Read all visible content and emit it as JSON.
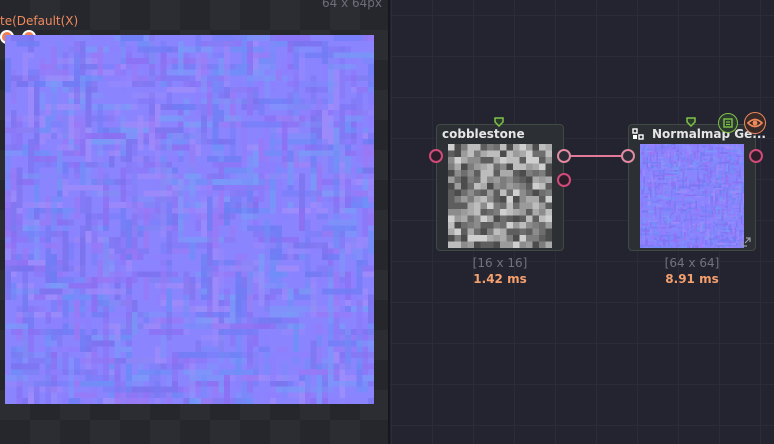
{
  "preview": {
    "size_label": "64 x 64px",
    "overlay_label": "te(Default(X)"
  },
  "graph": {
    "nodes": [
      {
        "title": "cobblestone",
        "size": "[16 x 16]",
        "time": "1.42 ms"
      },
      {
        "title": "Normalmap Ge...",
        "size": "[64 x 64]",
        "time": "8.91 ms"
      }
    ]
  },
  "colors": {
    "accent": "#f08a5d",
    "port": "#d14a78",
    "wire": "#e07a98",
    "top_port": "#7fc24a",
    "timing": "#f5a06e",
    "normal_base": "#8080ff"
  },
  "icons": [
    "eye-icon",
    "image-export-icon",
    "generator-icon",
    "expand-icon"
  ]
}
